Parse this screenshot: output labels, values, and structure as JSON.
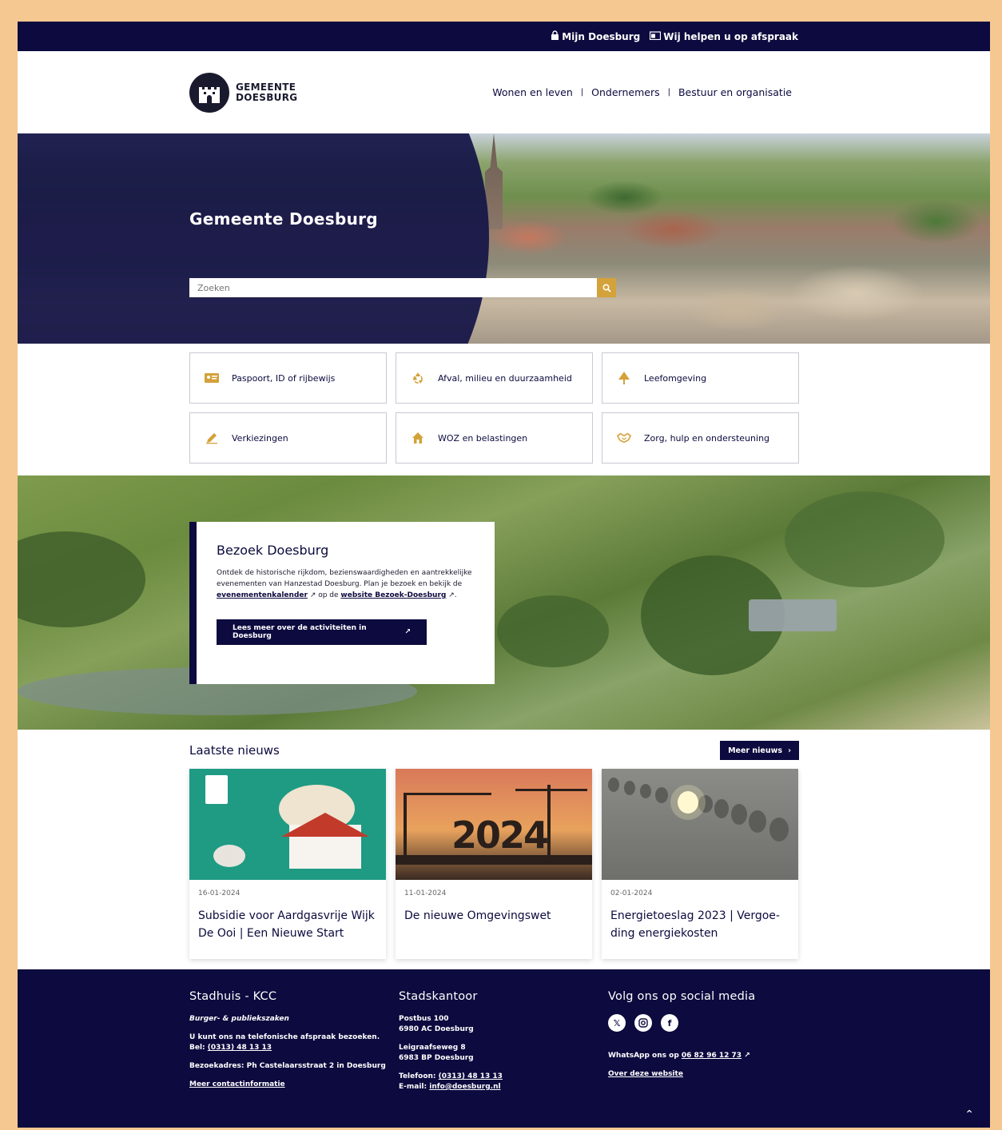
{
  "topbar": {
    "my_doesburg": "Mijn Doesburg",
    "appointment": "Wij helpen u op afspraak"
  },
  "header": {
    "logo_line1": "GEMEENTE",
    "logo_line2": "DOESBURG",
    "nav": [
      "Wonen en leven",
      "Ondernemers",
      "Bestuur en organisatie"
    ]
  },
  "hero": {
    "title": "Gemeente Doesburg",
    "search_placeholder": "Zoeken"
  },
  "tiles": [
    {
      "label": "Paspoort, ID of rijbewijs",
      "icon": "id-card-icon"
    },
    {
      "label": "Afval, milieu en duurzaamheid",
      "icon": "recycle-icon"
    },
    {
      "label": "Leefomgeving",
      "icon": "tree-icon"
    },
    {
      "label": "Verkiezingen",
      "icon": "pencil-icon"
    },
    {
      "label": "WOZ en belastingen",
      "icon": "house-icon"
    },
    {
      "label": "Zorg, hulp en ondersteuning",
      "icon": "handshake-icon"
    }
  ],
  "visit": {
    "title": "Bezoek Doesburg",
    "text_before": "Ontdek de historische rijkdom, bezienswaardigheden en aantrekkelijke evenementen van Hanzestad Doesburg. Plan je bezoek en bekijk de ",
    "link1": "evenementenkalender",
    "text_mid": " op de ",
    "link2": "website Bezoek-Doesburg",
    "text_after": ".",
    "button": "Lees meer over de activiteiten in Doesburg"
  },
  "news": {
    "heading": "Laatste nieuws",
    "more": "Meer nieuws",
    "items": [
      {
        "date": "16-01-2024",
        "title": "Subsidie voor Aardgasvrije Wijk De Ooi | Een Nieuwe Start"
      },
      {
        "date": "11-01-2024",
        "title": "De nieuwe Omgevingswet",
        "image_text": "2024"
      },
      {
        "date": "02-01-2024",
        "title": "Energietoeslag 2023 | Vergoe-ding energiekosten"
      }
    ]
  },
  "footer": {
    "col1": {
      "heading": "Stadhuis - KCC",
      "sub": "Burger- & publiekszaken",
      "l1": "U kunt ons na telefonische afspraak bezoeken.",
      "l2_prefix": "Bel: ",
      "phone": "(0313) 48 13 13",
      "address": "Bezoekadres: Ph Castelaarsstraat 2 in Doesburg",
      "more": "Meer contactinformatie"
    },
    "col2": {
      "heading": "Stadskantoor",
      "l1": "Postbus 100",
      "l2": "6980 AC Doesburg",
      "l3": "Leigraafseweg 8",
      "l4": "6983 BP Doesburg",
      "tel_prefix": "Telefoon: ",
      "tel": "(0313)  48 13 13",
      "mail_prefix": "E-mail: ",
      "mail": "info@doesburg.nl"
    },
    "col3": {
      "heading": "Volg ons op social media",
      "whatsapp_prefix": "WhatsApp ons op ",
      "whatsapp": "06 82 96 12 73",
      "about": "Over deze website"
    }
  },
  "colors": {
    "navy": "#0c0a3e",
    "gold": "#d4a23a",
    "frame": "#f6c891"
  }
}
